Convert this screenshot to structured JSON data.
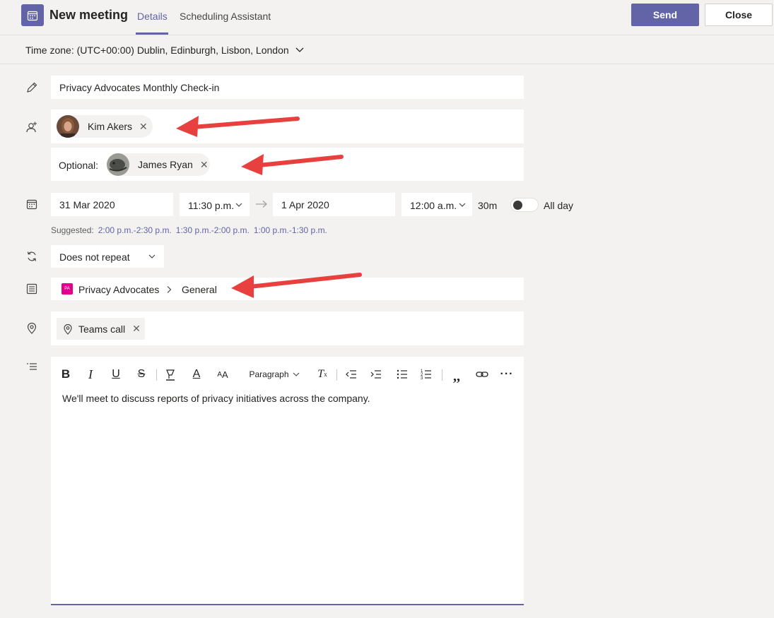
{
  "header": {
    "title": "New meeting",
    "tabs": [
      {
        "label": "Details",
        "active": true
      },
      {
        "label": "Scheduling Assistant",
        "active": false
      }
    ],
    "send_label": "Send",
    "close_label": "Close"
  },
  "timezone": {
    "label": "Time zone: (UTC+00:00) Dublin, Edinburgh, Lisbon, London"
  },
  "meeting": {
    "title": "Privacy Advocates Monthly Check-in",
    "required_attendees": [
      {
        "name": "Kim Akers"
      }
    ],
    "optional_label": "Optional:",
    "optional_attendees": [
      {
        "name": "James Ryan"
      }
    ],
    "start_date": "31 Mar 2020",
    "start_time": "11:30 p.m.",
    "end_date": "1 Apr 2020",
    "end_time": "12:00 a.m.",
    "duration": "30m",
    "all_day_label": "All day",
    "suggested_label": "Suggested:",
    "suggested_times": [
      "2:00 p.m.-2:30 p.m.",
      "1:30 p.m.-2:00 p.m.",
      "1:00 p.m.-1:30 p.m."
    ],
    "repeat": "Does not repeat",
    "channel": {
      "badge": "PA",
      "team": "Privacy Advocates",
      "channel": "General"
    },
    "location": "Teams call",
    "body": "We'll meet to discuss reports of privacy initiatives across the company."
  },
  "editor_toolbar": {
    "paragraph_label": "Paragraph"
  },
  "colors": {
    "accent": "#6264a7",
    "annotation_arrow": "#e8403f",
    "channel_badge": "#e3008c"
  }
}
